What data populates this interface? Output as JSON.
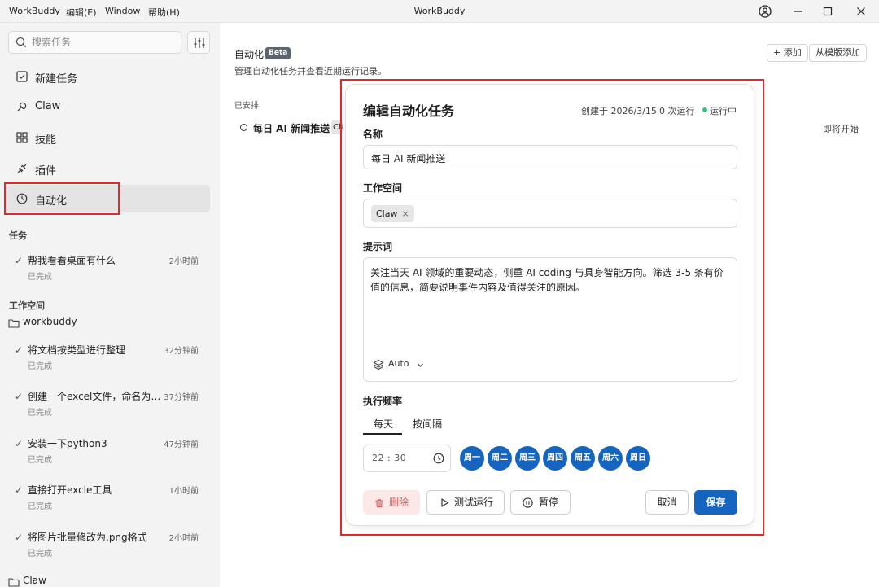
{
  "titlebar": {
    "menus": [
      "WorkBuddy",
      "编辑(E)",
      "Window",
      "帮助(H)"
    ],
    "title": "WorkBuddy"
  },
  "sidebar": {
    "search_placeholder": "搜索任务",
    "nav": [
      {
        "label": "新建任务",
        "icon": "new-task-icon"
      },
      {
        "label": "Claw",
        "icon": "claw-icon"
      },
      {
        "label": "技能",
        "icon": "skills-icon"
      },
      {
        "label": "插件",
        "icon": "plugin-icon"
      },
      {
        "label": "自动化",
        "icon": "clock-icon",
        "active": true
      }
    ],
    "tasks_heading": "任务",
    "tasks": [
      {
        "title": "帮我看看桌面有什么",
        "time": "2小时前",
        "status": "已完成"
      }
    ],
    "workspace_heading": "工作空间",
    "workspace_folder": "workbuddy",
    "workspace_tasks": [
      {
        "title": "将文档按类型进行整理",
        "time": "32分钟前",
        "status": "已完成"
      },
      {
        "title": "创建一个excel文件，命名为当...",
        "time": "37分钟前",
        "status": "已完成"
      },
      {
        "title": "安装一下python3",
        "time": "47分钟前",
        "status": "已完成"
      },
      {
        "title": "直接打开excle工具",
        "time": "1小时前",
        "status": "已完成"
      },
      {
        "title": "将图片批量修改为.png格式",
        "time": "2小时前",
        "status": "已完成"
      }
    ],
    "bottom_folder": "Claw"
  },
  "main": {
    "title": "自动化",
    "beta": "Beta",
    "subtitle": "管理自动化任务并查看近期运行记录。",
    "add_button": "+ 添加",
    "template_button": "从模版添加",
    "scheduled_label": "已安排",
    "task_row": {
      "name": "每日 AI 新闻推送",
      "tag": "Claw",
      "status": "即将开始"
    }
  },
  "modal": {
    "title": "编辑自动化任务",
    "created": "创建于 2026/3/15",
    "runs": "0 次运行",
    "state": "运行中",
    "state_color": "#35c37a",
    "name_label": "名称",
    "name_value": "每日 AI 新闻推送",
    "workspace_label": "工作空间",
    "workspace_chip": "Claw",
    "workspace_chip_x": "×",
    "prompt_label": "提示词",
    "prompt_text": "关注当天 AI 领域的重要动态，侧重 AI coding 与具身智能方向。筛选 3-5 条有价值的信息，简要说明事件内容及值得关注的原因。",
    "model": "Auto",
    "frequency_label": "执行频率",
    "tabs": [
      "每天",
      "按间隔"
    ],
    "active_tab": "每天",
    "time": "22 : 30",
    "days": [
      "周一",
      "周二",
      "周三",
      "周四",
      "周五",
      "周六",
      "周日"
    ],
    "accent_color": "#1565c0",
    "delete_button": "删除",
    "test_button": "测试运行",
    "pause_button": "暂停",
    "cancel_button": "取消",
    "save_button": "保存"
  }
}
